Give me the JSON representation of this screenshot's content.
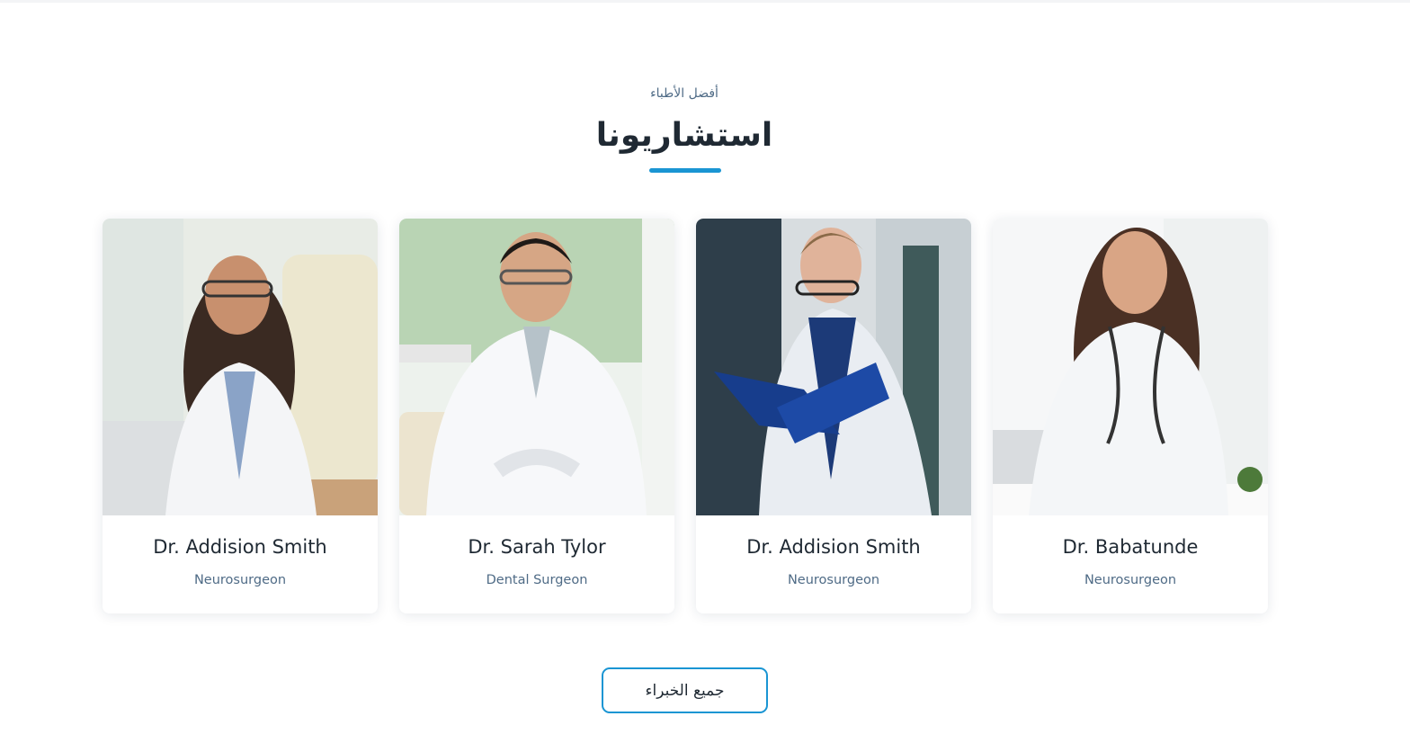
{
  "section": {
    "eyebrow": "أفضل الأطباء",
    "title": "استشاريونا",
    "accent_color": "#1a95d3"
  },
  "doctors": [
    {
      "name": "Dr. Addision Smith",
      "role": "Neurosurgeon",
      "photo_icon": "doctor-portrait-icon"
    },
    {
      "name": "Dr. Sarah Tylor",
      "role": "Dental Surgeon",
      "photo_icon": "doctor-portrait-icon"
    },
    {
      "name": "Dr. Addision Smith",
      "role": "Neurosurgeon",
      "photo_icon": "doctor-portrait-icon"
    },
    {
      "name": "Dr. Babatunde",
      "role": "Neurosurgeon",
      "photo_icon": "doctor-portrait-icon"
    }
  ],
  "cta": {
    "label": "جميع الخبراء"
  }
}
